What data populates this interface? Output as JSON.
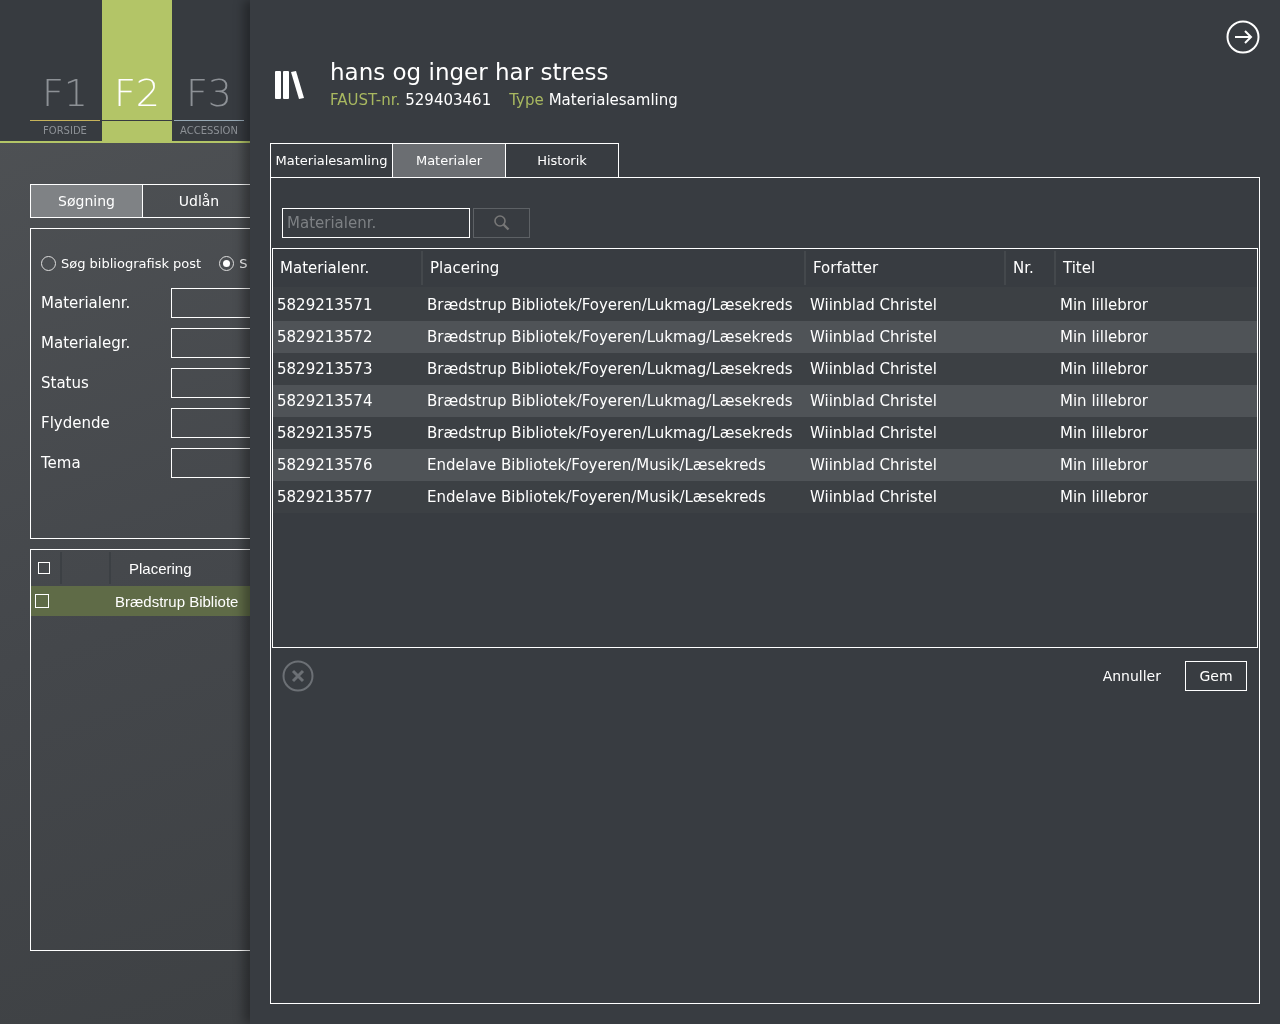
{
  "fkeys": [
    {
      "key": "F1",
      "label": "FORSIDE",
      "selected": false
    },
    {
      "key": "F2",
      "selected": true
    },
    {
      "key": "F3",
      "label": "ACCESSION",
      "selected": false
    }
  ],
  "side_tabs": [
    {
      "label": "Søgning",
      "selected": true
    },
    {
      "label": "Udlån",
      "selected": false
    }
  ],
  "radios": [
    {
      "label": "Søg bibliografisk post",
      "selected": false
    },
    {
      "label": "S",
      "selected": true
    }
  ],
  "side_fields": [
    "Materialenr.",
    "Materialegr.",
    "Status",
    "Flydende",
    "Tema"
  ],
  "side_grid": {
    "header": "Placering",
    "header_checked": false,
    "rows": [
      {
        "text": "Brædstrup Bibliote",
        "checked": false,
        "selected": true
      }
    ]
  },
  "record": {
    "title": "hans og inger har stress",
    "faust_label": "FAUST-nr.",
    "faust": "529403461",
    "type_label": "Type",
    "type": "Materialesamling"
  },
  "tabs": [
    {
      "label": "Materialesamling",
      "selected": false
    },
    {
      "label": "Materialer",
      "selected": true
    },
    {
      "label": "Historik",
      "selected": false
    }
  ],
  "search": {
    "placeholder": "Materialenr."
  },
  "table": {
    "columns": [
      "Materialenr.",
      "Placering",
      "Forfatter",
      "Nr.",
      "Titel"
    ],
    "rows": [
      {
        "cells": [
          "5829213571",
          "Brædstrup Bibliotek/Foyeren/Lukmag/Læsekreds",
          "Wiinblad Christel",
          "",
          "Min lillebror"
        ]
      },
      {
        "cells": [
          "5829213572",
          "Brædstrup Bibliotek/Foyeren/Lukmag/Læsekreds",
          "Wiinblad Christel",
          "",
          "Min lillebror"
        ]
      },
      {
        "cells": [
          "5829213573",
          "Brædstrup Bibliotek/Foyeren/Lukmag/Læsekreds",
          "Wiinblad Christel",
          "",
          "Min lillebror"
        ]
      },
      {
        "cells": [
          "5829213574",
          "Brædstrup Bibliotek/Foyeren/Lukmag/Læsekreds",
          "Wiinblad Christel",
          "",
          "Min lillebror"
        ]
      },
      {
        "cells": [
          "5829213575",
          "Brædstrup Bibliotek/Foyeren/Lukmag/Læsekreds",
          "Wiinblad Christel",
          "",
          "Min lillebror"
        ]
      },
      {
        "cells": [
          "5829213576",
          "Endelave Bibliotek/Foyeren/Musik/Læsekreds",
          "Wiinblad Christel",
          "",
          "Min lillebror"
        ]
      },
      {
        "cells": [
          "5829213577",
          "Endelave Bibliotek/Foyeren/Musik/Læsekreds",
          "Wiinblad Christel",
          "",
          "Min lillebror"
        ]
      }
    ]
  },
  "buttons": {
    "cancel": "Annuller",
    "save": "Gem"
  }
}
